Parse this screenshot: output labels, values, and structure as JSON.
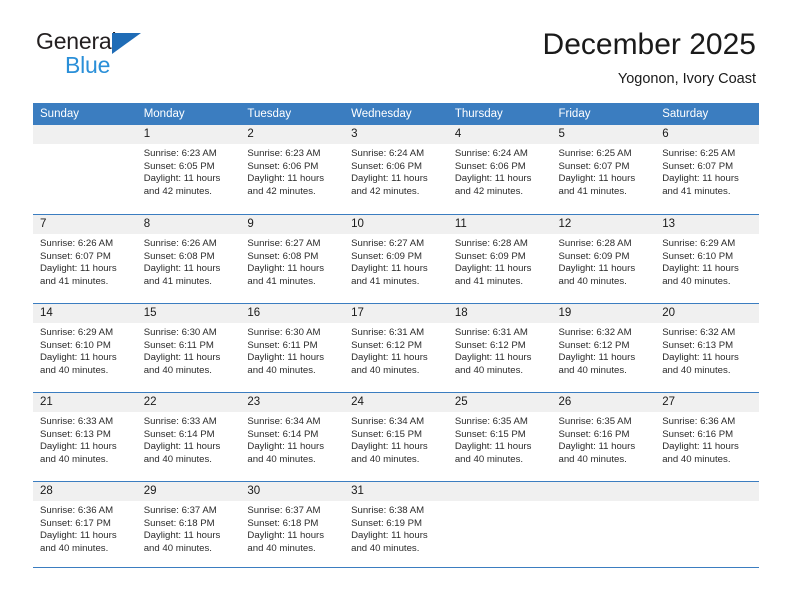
{
  "brand": {
    "name_line1": "General",
    "name_line2": "Blue",
    "triangle_icon": "triangle-icon",
    "accent_dark": "#1f6cb6",
    "accent_light": "#2a8fd8"
  },
  "header": {
    "title": "December 2025",
    "subtitle": "Yogonon, Ivory Coast"
  },
  "theme": {
    "header_row_bg": "#3b7dc0",
    "daynum_bg": "#f0f0f0",
    "grid_line": "#3b7dc0",
    "page_bg": "#ffffff",
    "text": "#1a1a1a"
  },
  "calendar": {
    "weekdays": [
      "Sunday",
      "Monday",
      "Tuesday",
      "Wednesday",
      "Thursday",
      "Friday",
      "Saturday"
    ],
    "weeks": [
      [
        {
          "day": "",
          "lines": []
        },
        {
          "day": "1",
          "lines": [
            "Sunrise: 6:23 AM",
            "Sunset: 6:05 PM",
            "Daylight: 11 hours",
            "and 42 minutes."
          ]
        },
        {
          "day": "2",
          "lines": [
            "Sunrise: 6:23 AM",
            "Sunset: 6:06 PM",
            "Daylight: 11 hours",
            "and 42 minutes."
          ]
        },
        {
          "day": "3",
          "lines": [
            "Sunrise: 6:24 AM",
            "Sunset: 6:06 PM",
            "Daylight: 11 hours",
            "and 42 minutes."
          ]
        },
        {
          "day": "4",
          "lines": [
            "Sunrise: 6:24 AM",
            "Sunset: 6:06 PM",
            "Daylight: 11 hours",
            "and 42 minutes."
          ]
        },
        {
          "day": "5",
          "lines": [
            "Sunrise: 6:25 AM",
            "Sunset: 6:07 PM",
            "Daylight: 11 hours",
            "and 41 minutes."
          ]
        },
        {
          "day": "6",
          "lines": [
            "Sunrise: 6:25 AM",
            "Sunset: 6:07 PM",
            "Daylight: 11 hours",
            "and 41 minutes."
          ]
        }
      ],
      [
        {
          "day": "7",
          "lines": [
            "Sunrise: 6:26 AM",
            "Sunset: 6:07 PM",
            "Daylight: 11 hours",
            "and 41 minutes."
          ]
        },
        {
          "day": "8",
          "lines": [
            "Sunrise: 6:26 AM",
            "Sunset: 6:08 PM",
            "Daylight: 11 hours",
            "and 41 minutes."
          ]
        },
        {
          "day": "9",
          "lines": [
            "Sunrise: 6:27 AM",
            "Sunset: 6:08 PM",
            "Daylight: 11 hours",
            "and 41 minutes."
          ]
        },
        {
          "day": "10",
          "lines": [
            "Sunrise: 6:27 AM",
            "Sunset: 6:09 PM",
            "Daylight: 11 hours",
            "and 41 minutes."
          ]
        },
        {
          "day": "11",
          "lines": [
            "Sunrise: 6:28 AM",
            "Sunset: 6:09 PM",
            "Daylight: 11 hours",
            "and 41 minutes."
          ]
        },
        {
          "day": "12",
          "lines": [
            "Sunrise: 6:28 AM",
            "Sunset: 6:09 PM",
            "Daylight: 11 hours",
            "and 40 minutes."
          ]
        },
        {
          "day": "13",
          "lines": [
            "Sunrise: 6:29 AM",
            "Sunset: 6:10 PM",
            "Daylight: 11 hours",
            "and 40 minutes."
          ]
        }
      ],
      [
        {
          "day": "14",
          "lines": [
            "Sunrise: 6:29 AM",
            "Sunset: 6:10 PM",
            "Daylight: 11 hours",
            "and 40 minutes."
          ]
        },
        {
          "day": "15",
          "lines": [
            "Sunrise: 6:30 AM",
            "Sunset: 6:11 PM",
            "Daylight: 11 hours",
            "and 40 minutes."
          ]
        },
        {
          "day": "16",
          "lines": [
            "Sunrise: 6:30 AM",
            "Sunset: 6:11 PM",
            "Daylight: 11 hours",
            "and 40 minutes."
          ]
        },
        {
          "day": "17",
          "lines": [
            "Sunrise: 6:31 AM",
            "Sunset: 6:12 PM",
            "Daylight: 11 hours",
            "and 40 minutes."
          ]
        },
        {
          "day": "18",
          "lines": [
            "Sunrise: 6:31 AM",
            "Sunset: 6:12 PM",
            "Daylight: 11 hours",
            "and 40 minutes."
          ]
        },
        {
          "day": "19",
          "lines": [
            "Sunrise: 6:32 AM",
            "Sunset: 6:12 PM",
            "Daylight: 11 hours",
            "and 40 minutes."
          ]
        },
        {
          "day": "20",
          "lines": [
            "Sunrise: 6:32 AM",
            "Sunset: 6:13 PM",
            "Daylight: 11 hours",
            "and 40 minutes."
          ]
        }
      ],
      [
        {
          "day": "21",
          "lines": [
            "Sunrise: 6:33 AM",
            "Sunset: 6:13 PM",
            "Daylight: 11 hours",
            "and 40 minutes."
          ]
        },
        {
          "day": "22",
          "lines": [
            "Sunrise: 6:33 AM",
            "Sunset: 6:14 PM",
            "Daylight: 11 hours",
            "and 40 minutes."
          ]
        },
        {
          "day": "23",
          "lines": [
            "Sunrise: 6:34 AM",
            "Sunset: 6:14 PM",
            "Daylight: 11 hours",
            "and 40 minutes."
          ]
        },
        {
          "day": "24",
          "lines": [
            "Sunrise: 6:34 AM",
            "Sunset: 6:15 PM",
            "Daylight: 11 hours",
            "and 40 minutes."
          ]
        },
        {
          "day": "25",
          "lines": [
            "Sunrise: 6:35 AM",
            "Sunset: 6:15 PM",
            "Daylight: 11 hours",
            "and 40 minutes."
          ]
        },
        {
          "day": "26",
          "lines": [
            "Sunrise: 6:35 AM",
            "Sunset: 6:16 PM",
            "Daylight: 11 hours",
            "and 40 minutes."
          ]
        },
        {
          "day": "27",
          "lines": [
            "Sunrise: 6:36 AM",
            "Sunset: 6:16 PM",
            "Daylight: 11 hours",
            "and 40 minutes."
          ]
        }
      ],
      [
        {
          "day": "28",
          "lines": [
            "Sunrise: 6:36 AM",
            "Sunset: 6:17 PM",
            "Daylight: 11 hours",
            "and 40 minutes."
          ]
        },
        {
          "day": "29",
          "lines": [
            "Sunrise: 6:37 AM",
            "Sunset: 6:18 PM",
            "Daylight: 11 hours",
            "and 40 minutes."
          ]
        },
        {
          "day": "30",
          "lines": [
            "Sunrise: 6:37 AM",
            "Sunset: 6:18 PM",
            "Daylight: 11 hours",
            "and 40 minutes."
          ]
        },
        {
          "day": "31",
          "lines": [
            "Sunrise: 6:38 AM",
            "Sunset: 6:19 PM",
            "Daylight: 11 hours",
            "and 40 minutes."
          ]
        },
        {
          "day": "",
          "lines": []
        },
        {
          "day": "",
          "lines": []
        },
        {
          "day": "",
          "lines": []
        }
      ]
    ]
  }
}
